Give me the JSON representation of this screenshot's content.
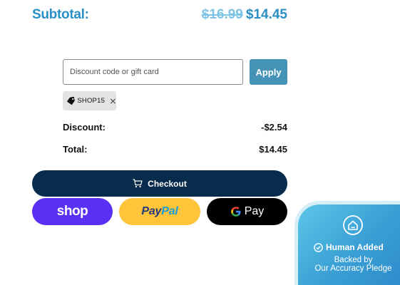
{
  "subtotal": {
    "label": "Subtotal:",
    "original_price": "$16.99",
    "discounted_price": "$14.45"
  },
  "discount_form": {
    "placeholder": "Discount code or gift card",
    "value": "",
    "apply_label": "Apply"
  },
  "applied_code": {
    "code": "SHOP15",
    "icon": "tag-icon",
    "remove_icon": "close-icon"
  },
  "summary": {
    "discount_label": "Discount:",
    "discount_value": "-$2.54",
    "total_label": "Total:",
    "total_value": "$14.45"
  },
  "checkout": {
    "label": "Checkout",
    "icon": "cart-icon"
  },
  "payment_options": {
    "shop_label": "shop",
    "paypal_label_1": "Pay",
    "paypal_label_2": "Pal",
    "gpay_label": "Pay"
  },
  "badge": {
    "title": "Human Added",
    "line1": "Backed by",
    "line2": "Our Accuracy Pledge",
    "icon": "house-icon"
  },
  "colors": {
    "accent": "#2a8fc4",
    "apply": "#4594b7",
    "checkout": "#072c4c",
    "shop": "#5a31f4",
    "paypal": "#ffc43a",
    "gpay": "#000000"
  }
}
